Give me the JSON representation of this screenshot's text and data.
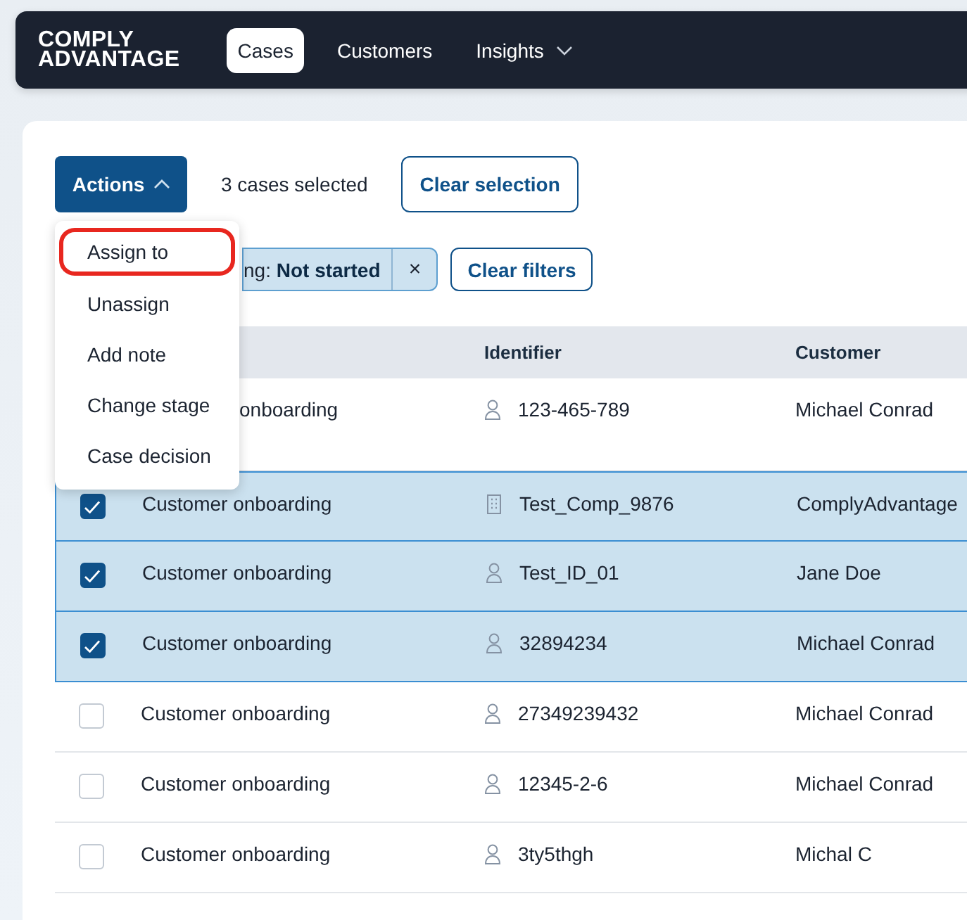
{
  "nav": {
    "logo_lines": [
      "COMPLY",
      "ADVANTAGE"
    ],
    "tabs": [
      {
        "label": "Cases",
        "selected": true,
        "dropdown": false
      },
      {
        "label": "Customers",
        "selected": false,
        "dropdown": false
      },
      {
        "label": "Insights",
        "selected": false,
        "dropdown": true
      }
    ]
  },
  "toolbar": {
    "actions_button": "Actions",
    "actions_open": true,
    "selection_count": "3 cases selected",
    "clear_selection": "Clear selection"
  },
  "actions_menu": [
    {
      "label": "Assign to",
      "highlighted": true
    },
    {
      "label": "Unassign",
      "highlighted": false
    },
    {
      "label": "Add note",
      "highlighted": false
    },
    {
      "label": "Change stage",
      "highlighted": false
    },
    {
      "label": "Case decision",
      "highlighted": false
    }
  ],
  "filters": {
    "chips": [
      {
        "text": "ng: **Not started**",
        "remove": "×"
      }
    ],
    "clear_filters": "Clear filters"
  },
  "table": {
    "columns": [
      "Identifier",
      "Customer"
    ],
    "rows": [
      {
        "selected": false,
        "type": "onboarding",
        "kind": "person",
        "identifier": "123-465-789",
        "customer": "Michael Conrad"
      },
      {
        "selected": true,
        "type": "Customer onboarding",
        "kind": "company",
        "identifier": "Test_Comp_9876",
        "customer": "ComplyAdvantage"
      },
      {
        "selected": true,
        "type": "Customer onboarding",
        "kind": "person",
        "identifier": "Test_ID_01",
        "customer": "Jane Doe"
      },
      {
        "selected": true,
        "type": "Customer onboarding",
        "kind": "person",
        "identifier": "32894234",
        "customer": "Michael Conrad"
      },
      {
        "selected": false,
        "type": "Customer onboarding",
        "kind": "person",
        "identifier": "27349239432",
        "customer": "Michael Conrad"
      },
      {
        "selected": false,
        "type": "Customer onboarding",
        "kind": "person",
        "identifier": "12345-2-6",
        "customer": "Michael Conrad"
      },
      {
        "selected": false,
        "type": "Customer onboarding",
        "kind": "person",
        "identifier": "3ty5thgh",
        "customer": "Michal C"
      }
    ]
  }
}
